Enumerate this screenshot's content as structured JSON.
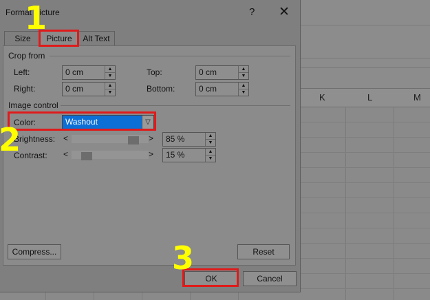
{
  "dialog": {
    "title": "Format Picture",
    "help": "?",
    "close": "✕",
    "tabs": [
      {
        "label": "Size"
      },
      {
        "label": "Picture"
      },
      {
        "label": "Alt Text"
      }
    ]
  },
  "crop": {
    "heading": "Crop from",
    "left_label": "Left:",
    "left_value": "0 cm",
    "right_label": "Right:",
    "right_value": "0 cm",
    "top_label": "Top:",
    "top_value": "0 cm",
    "bottom_label": "Bottom:",
    "bottom_value": "0 cm"
  },
  "image_control": {
    "heading": "Image control",
    "color_label": "Color:",
    "color_value": "Washout",
    "brightness_label": "Brightness:",
    "brightness_value": "85 %",
    "brightness_level_percent": 85,
    "contrast_label": "Contrast:",
    "contrast_value": "15 %",
    "contrast_level_percent": 15
  },
  "buttons": {
    "compress": "Compress...",
    "reset": "Reset",
    "ok": "OK",
    "cancel": "Cancel"
  },
  "spreadsheet": {
    "columns": [
      "K",
      "L",
      "M"
    ]
  },
  "markers": [
    "1",
    "2",
    "3"
  ],
  "colors": {
    "highlight": "#e01a1a",
    "marker": "#ffff00",
    "selection": "#0c6fd6"
  }
}
